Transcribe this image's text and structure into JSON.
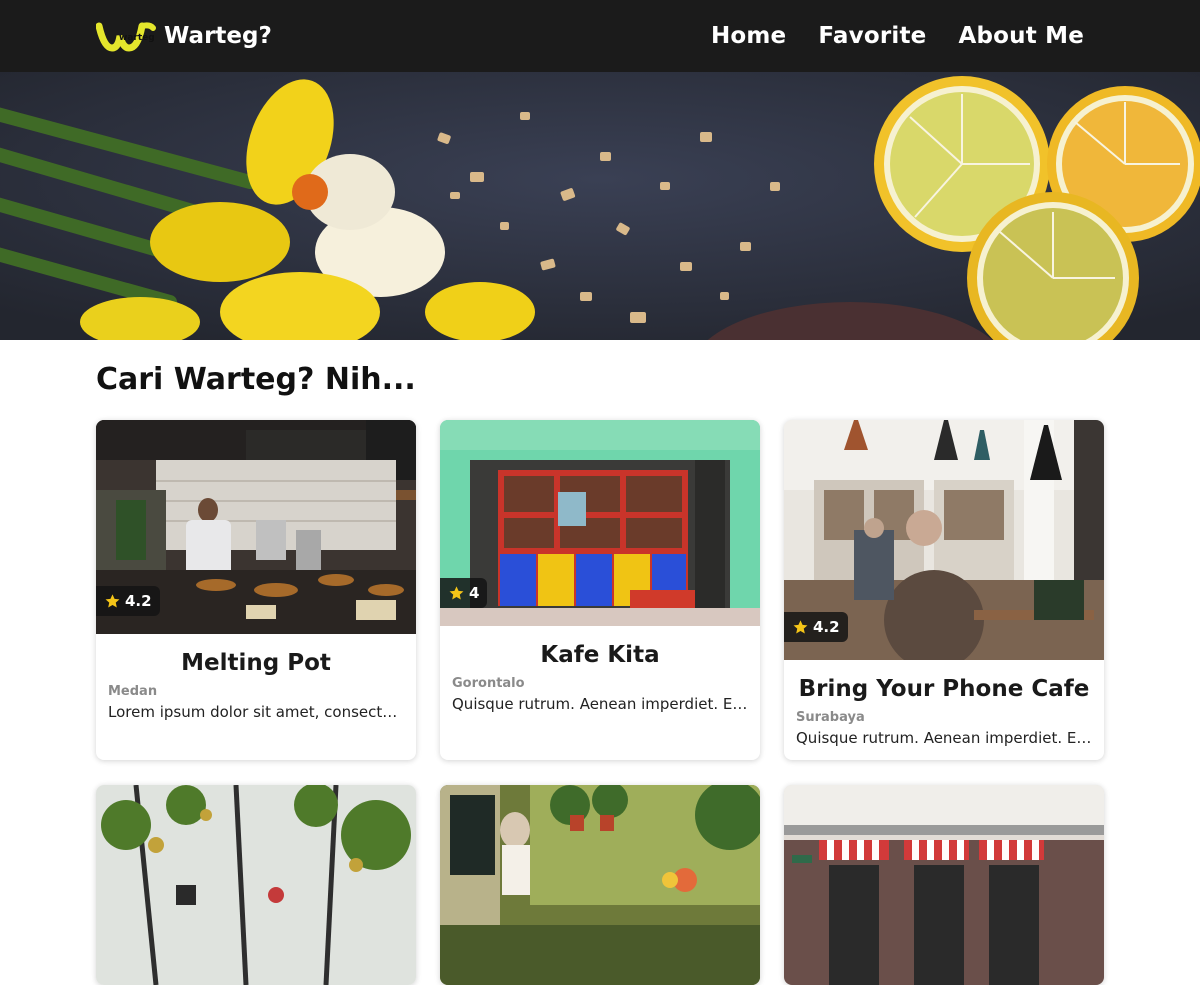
{
  "header": {
    "logo_text": "warteg",
    "brand": "Warteg?",
    "nav": [
      {
        "label": "Home"
      },
      {
        "label": "Favorite"
      },
      {
        "label": "About Me"
      }
    ]
  },
  "hero": {
    "alt": "Daffodils, lemons and nuts on a dark table"
  },
  "section": {
    "title": "Cari Warteg? Nih..."
  },
  "cards": [
    {
      "name": "Melting Pot",
      "city": "Medan",
      "rating": "4.2",
      "description": "Lorem ipsum dolor sit amet, consectetur adipiscing elit."
    },
    {
      "name": "Kafe Kita",
      "city": "Gorontalo",
      "rating": "4",
      "description": "Quisque rutrum. Aenean imperdiet. Etiam ultricies nisi vel augue."
    },
    {
      "name": "Bring Your Phone Cafe",
      "city": "Surabaya",
      "rating": "4.2",
      "description": "Quisque rutrum. Aenean imperdiet. Etiam ultricies nisi vel augue."
    }
  ],
  "colors": {
    "header_bg": "#1b1b1b",
    "logo_yellow": "#e4e62c",
    "star": "#f5c518"
  }
}
